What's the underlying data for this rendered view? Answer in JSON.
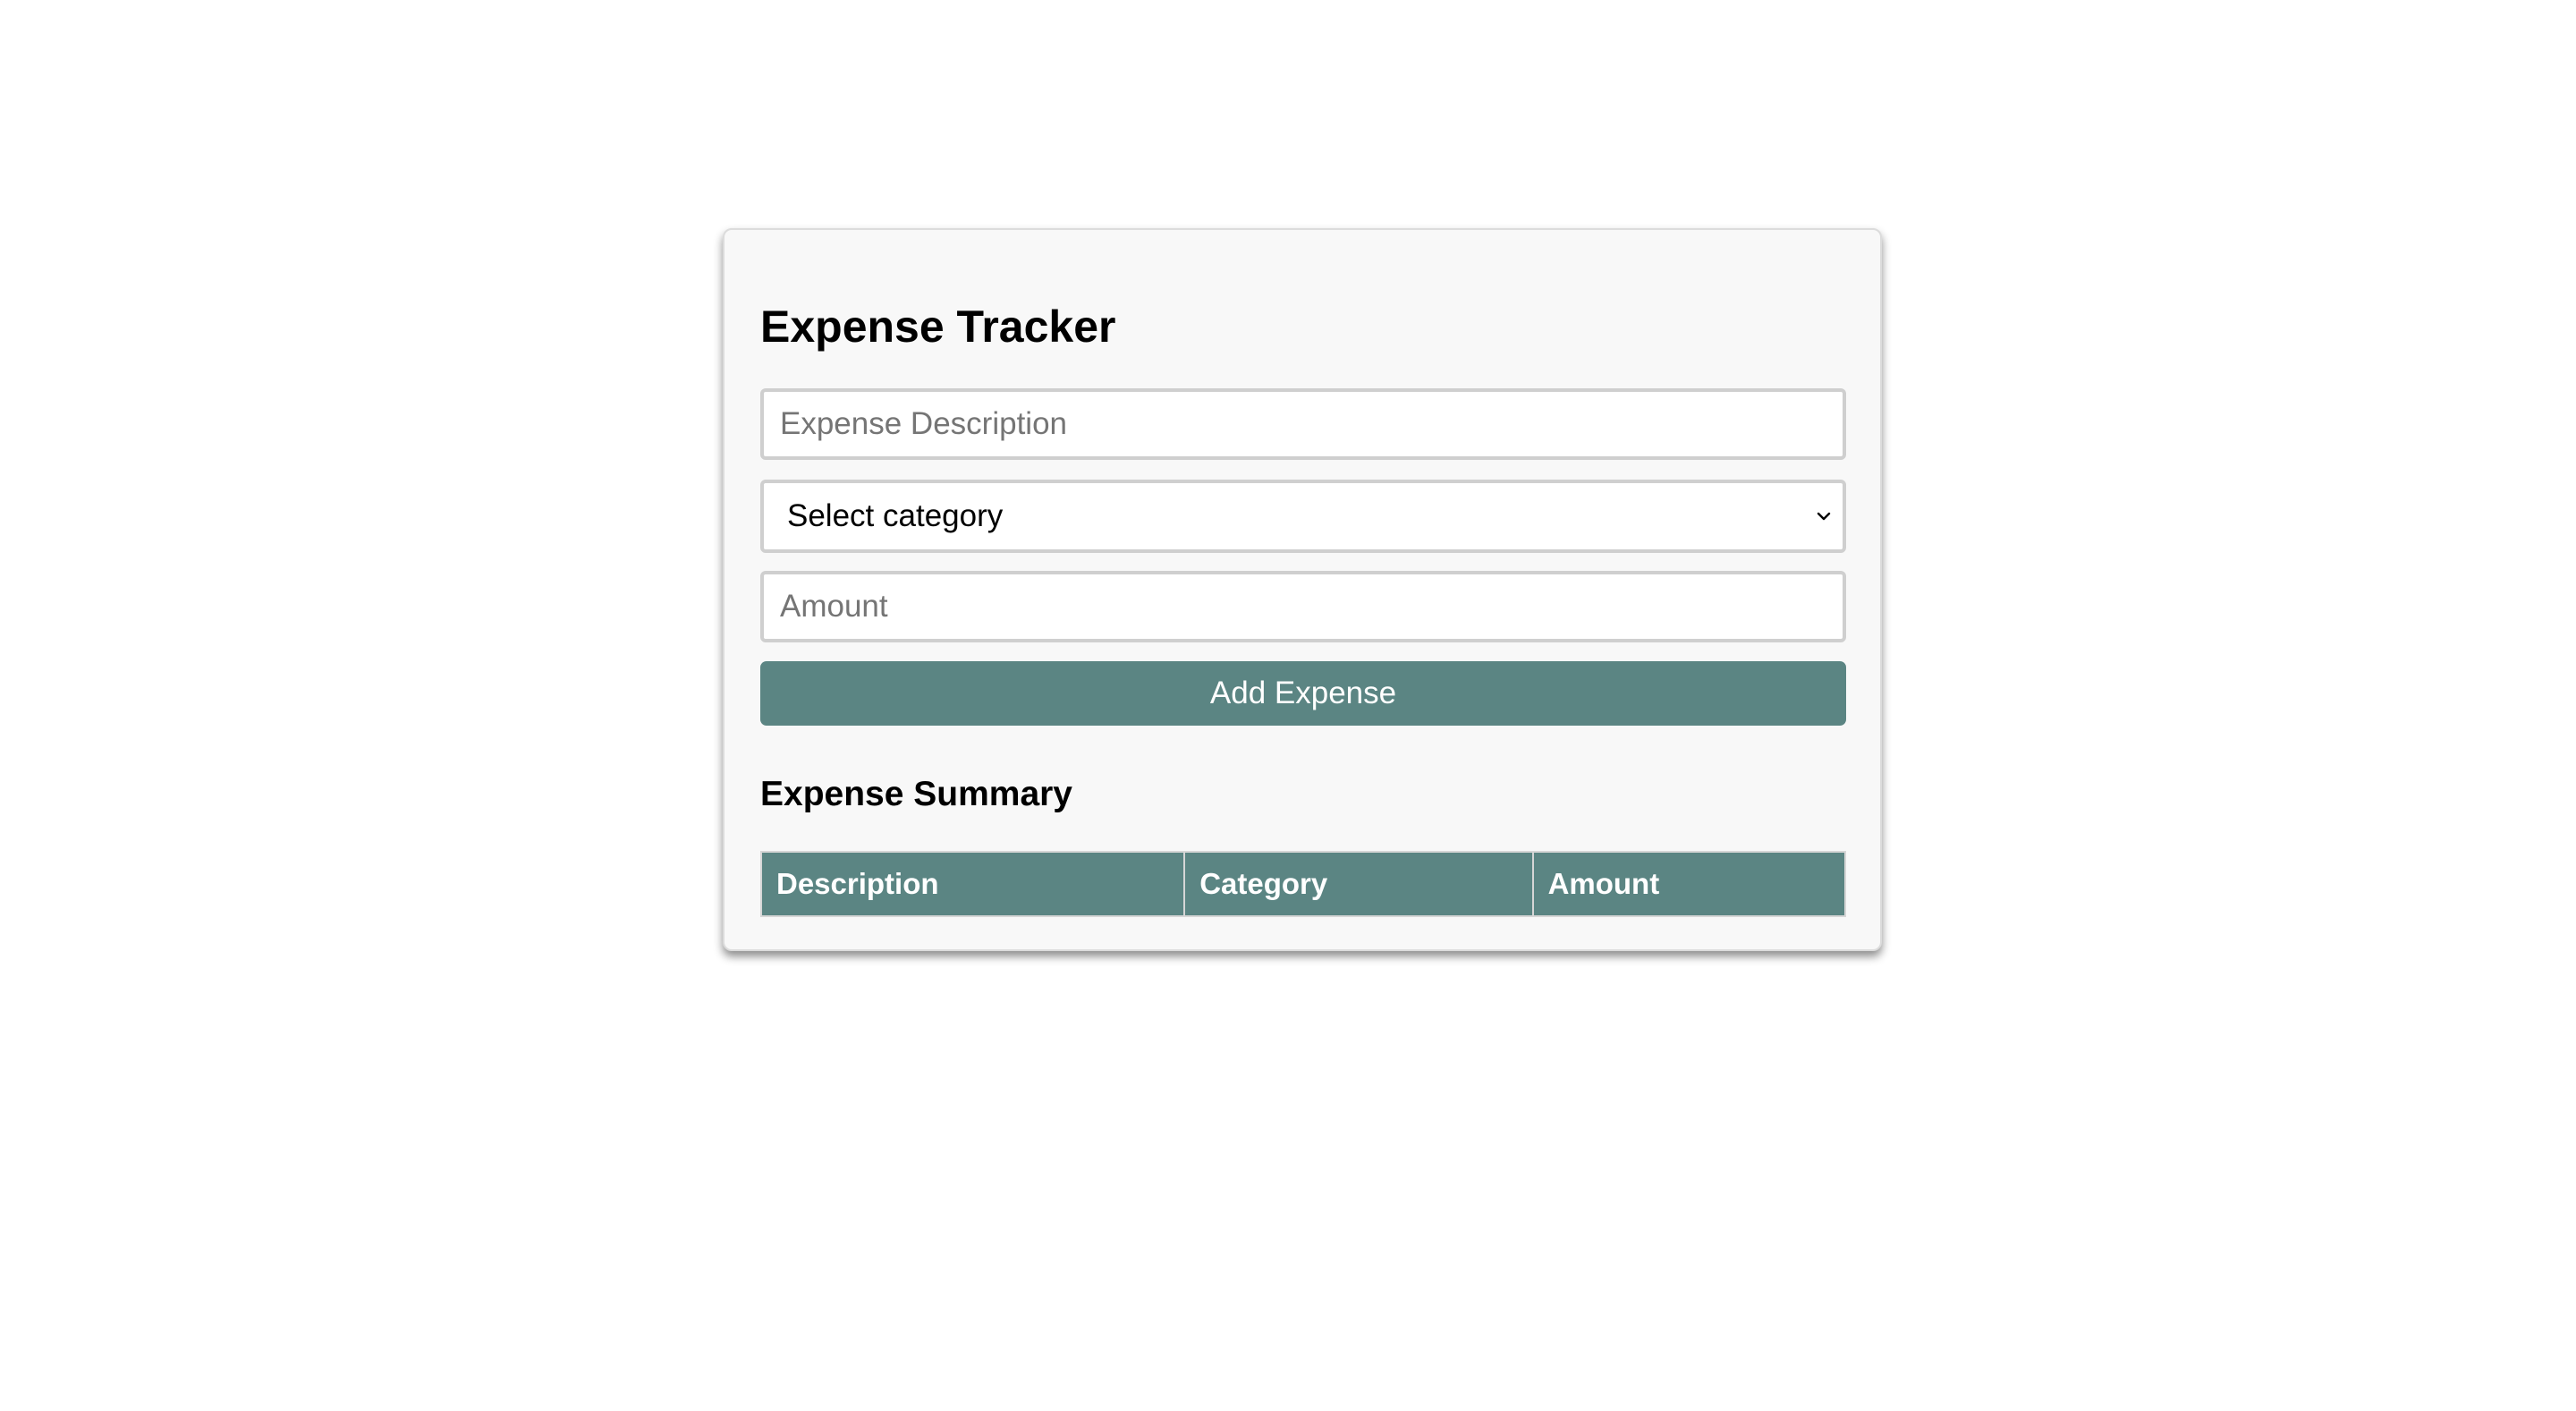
{
  "app": {
    "title": "Expense Tracker"
  },
  "form": {
    "description_placeholder": "Expense Description",
    "description_value": "",
    "category_selected": "Select category",
    "amount_placeholder": "Amount",
    "amount_value": "",
    "add_button_label": "Add Expense"
  },
  "summary": {
    "title": "Expense Summary",
    "columns": [
      "Description",
      "Category",
      "Amount"
    ],
    "rows": []
  },
  "colors": {
    "accent": "#5b8583",
    "card_background": "#f8f8f8"
  },
  "icons": {
    "select_arrow": "chevron-down-icon"
  }
}
